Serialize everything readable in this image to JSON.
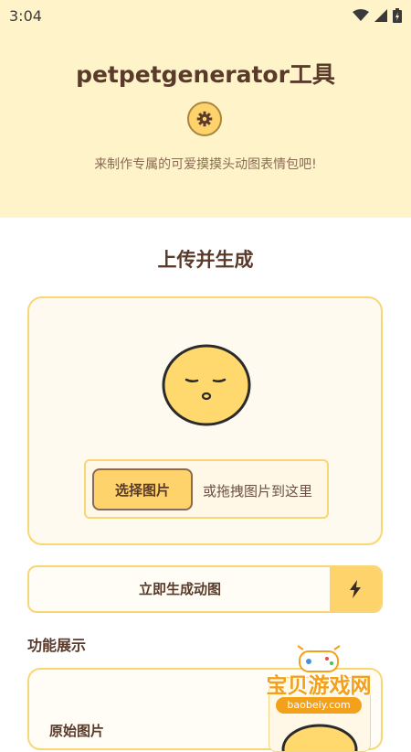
{
  "status_bar": {
    "time": "3:04"
  },
  "header": {
    "title": "petpetgenerator工具",
    "subtitle": "来制作专属的可爱摸摸头动图表情包吧!"
  },
  "upload": {
    "section_title": "上传并生成",
    "choose_button": "选择图片",
    "drop_hint": "或拖拽图片到这里"
  },
  "generate": {
    "label": "立即生成动图"
  },
  "features": {
    "title": "功能展示",
    "original_label": "原始图片"
  },
  "watermark": {
    "brand": "宝贝游戏网",
    "url": "baobeiy.com"
  },
  "colors": {
    "header_bg": "#fff3c9",
    "accent_yellow": "#ffd36b",
    "border_yellow": "#f7d775",
    "text_brown": "#5a3a2a"
  },
  "icons": [
    "wifi-icon",
    "signal-icon",
    "battery-icon",
    "gear-icon",
    "lightning-icon",
    "sleepy-face-icon",
    "gamepad-icon"
  ]
}
